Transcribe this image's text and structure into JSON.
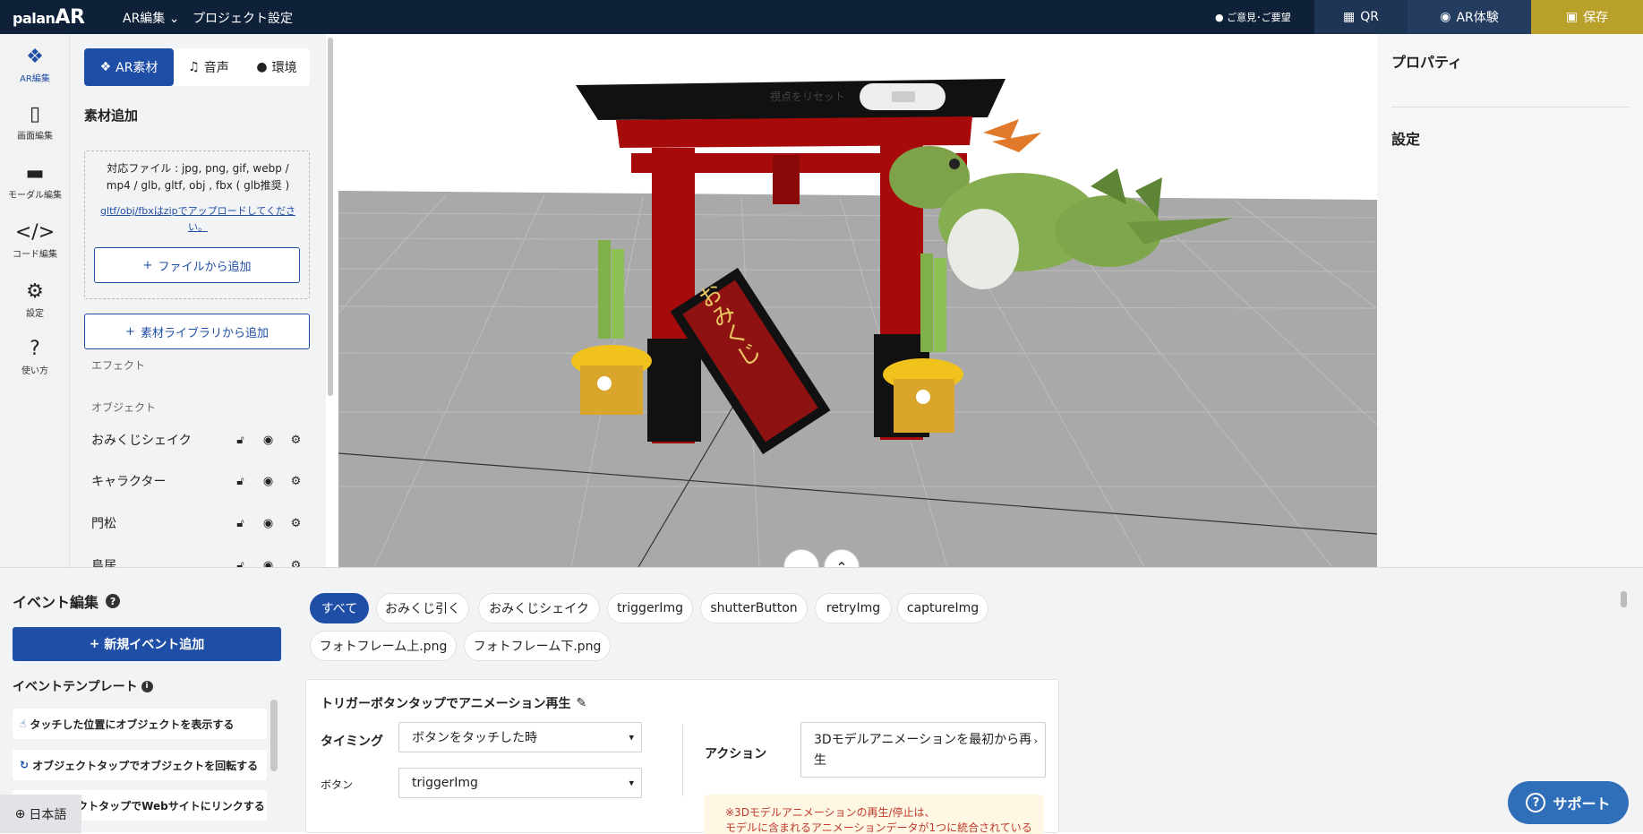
{
  "topbar": {
    "logo_small": "palan",
    "logo_big": "AR",
    "menu_ar_edit": "AR編集",
    "menu_project": "プロジェクト設定",
    "feedback": "ご意見･ご要望",
    "qr": "QR",
    "ar_experience": "AR体験",
    "save": "保存"
  },
  "rail": {
    "items": [
      {
        "label": "AR編集",
        "icon": "cubes-icon"
      },
      {
        "label": "画面編集",
        "icon": "phone-icon"
      },
      {
        "label": "モーダル編集",
        "icon": "comment-icon"
      },
      {
        "label": "コード編集",
        "icon": "code-icon"
      },
      {
        "label": "設定",
        "icon": "gear-icon"
      },
      {
        "label": "使い方",
        "icon": "question-icon"
      }
    ]
  },
  "left_panel": {
    "tabs": [
      "AR素材",
      "音声",
      "環境"
    ],
    "section_title": "素材追加",
    "file_types_line1": "対応ファイル : jpg, png, gif, webp /",
    "file_types_line2": "mp4 / glb, gltf, obj , fbx ( glb推奨 )",
    "zip_link_line1": "gltf/obj/fbxはzipでアップロードしてくださ",
    "zip_link_line2": "い。",
    "add_from_file": "ファイルから追加",
    "add_from_library": "素材ライブラリから追加",
    "effects_label": "エフェクト",
    "objects_label": "オブジェクト",
    "objects": [
      "おみくじシェイク",
      "キャラクター",
      "門松",
      "鳥居"
    ]
  },
  "viewport": {
    "reset_view": "視点をリセット",
    "omikuji_text": "おみくじ"
  },
  "properties": {
    "title": "プロパティ",
    "settings": "設定"
  },
  "events": {
    "title": "イベント編集",
    "new_event": "新規イベント追加",
    "template_title": "イベントテンプレート",
    "templates": [
      "タッチした位置にオブジェクトを表示する",
      "オブジェクトタップでオブジェクトを回転する",
      "オブジェクトタップでWebサイトにリンクする"
    ],
    "filters": [
      "すべて",
      "おみくじ引く",
      "おみくじシェイク",
      "triggerImg",
      "shutterButton",
      "retryImg",
      "captureImg",
      "フォトフレーム上.png",
      "フォトフレーム下.png"
    ],
    "card": {
      "title": "トリガーボタンタップでアニメーション再生",
      "timing_label": "タイミング",
      "timing_value": "ボタンをタッチした時",
      "button_label": "ボタン",
      "button_value": "triggerImg",
      "action_label": "アクション",
      "action_value_line1": "3Dモデルアニメーションを最初から再",
      "action_value_line2": "生",
      "warning_line1": "※3Dモデルアニメーションの再生/停止は、",
      "warning_line2": "モデルに含まれるアニメーションデータが1つに統合されている"
    },
    "language": "日本語",
    "support": "サポート"
  }
}
